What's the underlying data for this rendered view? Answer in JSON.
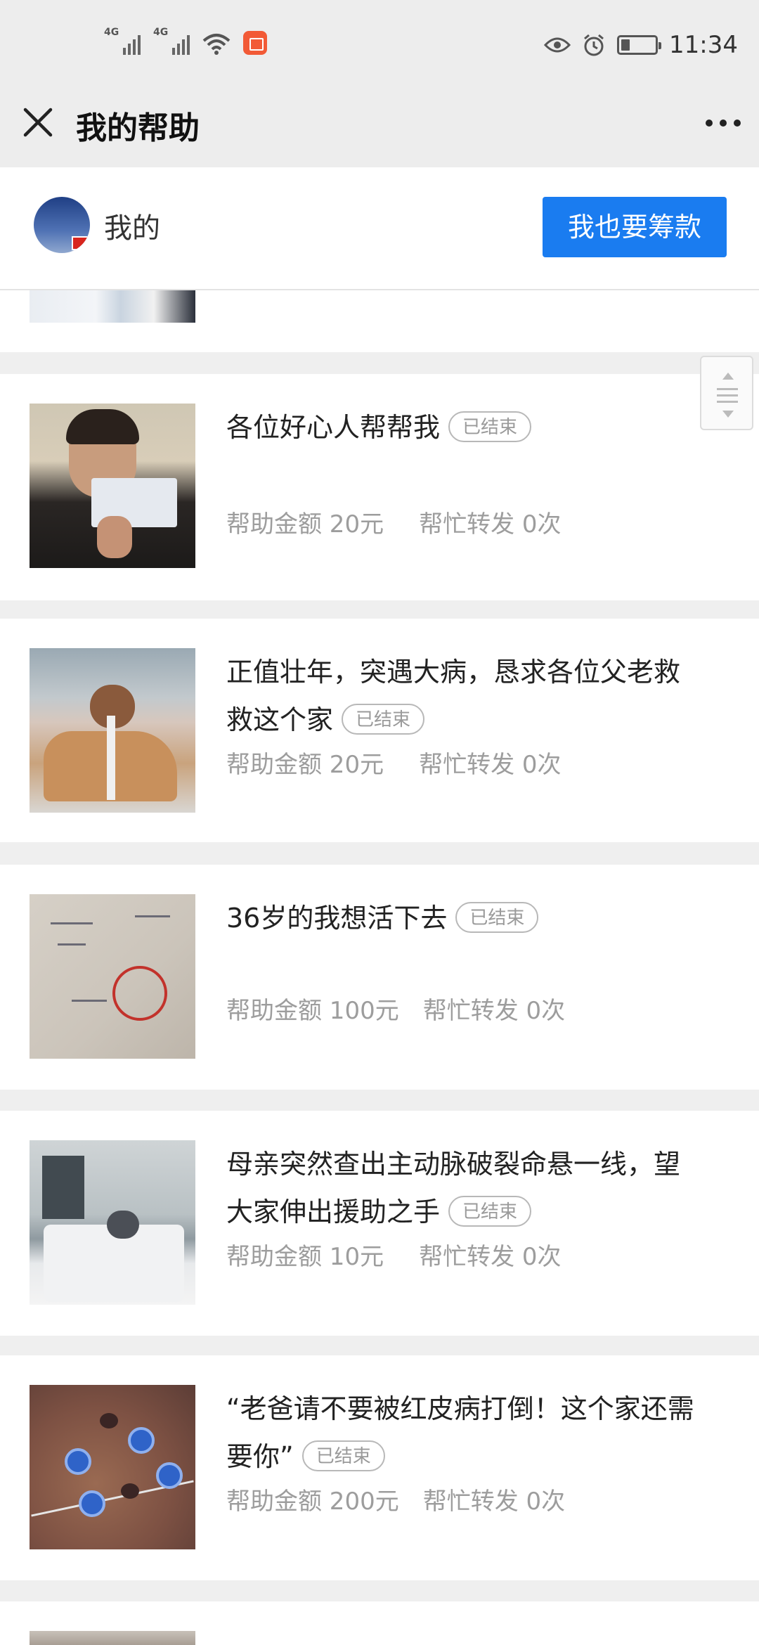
{
  "status_bar": {
    "net1": "4G",
    "net2": "4G",
    "time": "11:34"
  },
  "titlebar": {
    "title": "我的帮助",
    "close_icon": "close-icon",
    "more_icon": "more-icon"
  },
  "user": {
    "name": "我的",
    "raise_button": "我也要筹款"
  },
  "items": [
    {
      "title": "各位好心人帮帮我",
      "status": "已结束",
      "amount": "帮助金额 20元",
      "shares": "帮忙转发 0次"
    },
    {
      "title": "正值壮年，突遇大病，恳求各位父老救救这个家",
      "status": "已结束",
      "amount": "帮助金额 20元",
      "shares": "帮忙转发 0次"
    },
    {
      "title": "36岁的我想活下去",
      "status": "已结束",
      "amount": "帮助金额 100元",
      "shares": "帮忙转发 0次"
    },
    {
      "title": "母亲突然查出主动脉破裂命悬一线，望大家伸出援助之手",
      "status": "已结束",
      "amount": "帮助金额 10元",
      "shares": "帮忙转发 0次"
    },
    {
      "title": "“老爸请不要被红皮病打倒！这个家还需要你”",
      "status": "已结束",
      "amount": "帮助金额 200元",
      "shares": "帮忙转发 0次"
    }
  ],
  "colors": {
    "accent": "#1a7cf0",
    "page_bg": "#efefef"
  }
}
